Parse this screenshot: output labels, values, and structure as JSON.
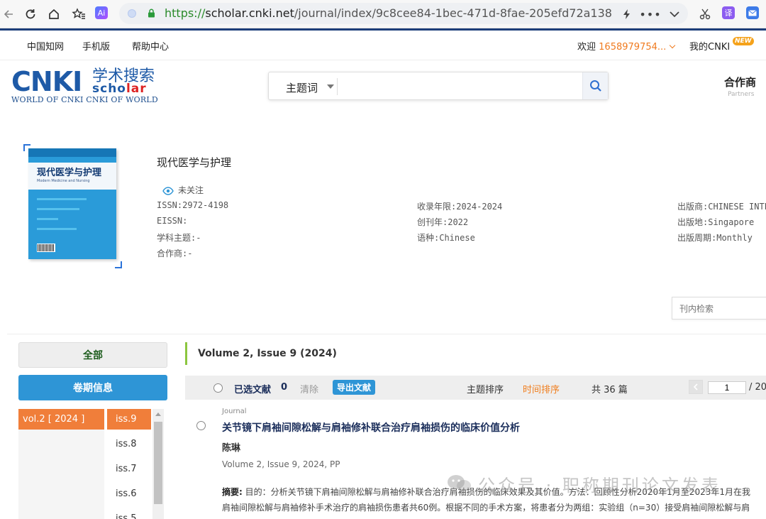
{
  "browser": {
    "url_scheme": "https://",
    "url_host": "scholar.cnki.net",
    "url_path": "/journal/index/9c8cee84-1bec-471d-8fae-205efd72a138",
    "ext_ai": "Ai",
    "ext_translate": "译"
  },
  "topnav": {
    "cnki": "中国知网",
    "mobile": "手机版",
    "help": "帮助中心",
    "welcome": "欢迎",
    "user": "1658979754...",
    "mycnki": "我的CNKI",
    "new_badge": "NEW"
  },
  "logo": {
    "cnki": "CNKI",
    "xueshu": "学术搜索",
    "scholar_a": "scho",
    "scholar_b": "lar",
    "tagline": "WORLD OF CNKI CNKI OF WORLD"
  },
  "search": {
    "category": "主题词",
    "value": "",
    "icon": "search-icon"
  },
  "partner": {
    "label": "合作商",
    "sub": "Partners"
  },
  "journal": {
    "title": "现代医学与护理",
    "cover_title": "现代医学与护理",
    "cover_subtitle": "Modern Medicine and Nursing",
    "follow": "未关注",
    "issn": "ISSN:2972-4198",
    "eissn": "EISSN:",
    "subject": "学科主题:-",
    "partner": "合作商:-",
    "years": "收录年限:2024-2024",
    "founded": "创刊年:2022",
    "language": "语种:Chinese",
    "publisher": "出版商:CHINESE INTER",
    "place": "出版地:Singapore",
    "period": "出版周期:Monthly"
  },
  "inner_search": {
    "placeholder": "刊内检索"
  },
  "left": {
    "all": "全部",
    "issue_info": "卷期信息",
    "volume": "vol.2 [ 2024 ]",
    "issues": [
      "iss.9",
      "iss.8",
      "iss.7",
      "iss.6",
      "iss.5"
    ]
  },
  "right": {
    "volume_title": "Volume 2, Issue 9 (2024)",
    "selected": "已选文献",
    "selected_count": "0",
    "clear": "清除",
    "export": "导出文献",
    "sort_topic": "主题排序",
    "sort_time": "时间排序",
    "total": "共 36 篇",
    "page": "1",
    "page_total": "/ 20"
  },
  "article": {
    "type": "Journal",
    "title": "关节镜下肩袖间隙松解与肩袖修补联合治疗肩袖损伤的临床价值分析",
    "author": "陈琳",
    "source": "Volume 2, Issue 9, 2024, PP",
    "abstract_label": "摘要:",
    "abstract_line1": " 目的：分析关节镜下肩袖间隙松解与肩袖修补联合治疗肩袖损伤的临床效果及其价值。方法：回顾性分析2020年1月至2023年1月在我",
    "abstract_line2": "肩袖间隙松解与肩袖修补手术治疗的肩袖损伤患者共60例。根据不同的手术方案，将患者分为两组：实验组（n=30）接受肩袖间隙松解与肩"
  },
  "watermark": {
    "text": "公众号 · 职称期刊论文发表"
  },
  "colors": {
    "accent_blue": "#2e95d6",
    "accent_orange": "#f07e3a",
    "brand_blue": "#1e5aa7",
    "header_bar": "#1d3e7a"
  }
}
